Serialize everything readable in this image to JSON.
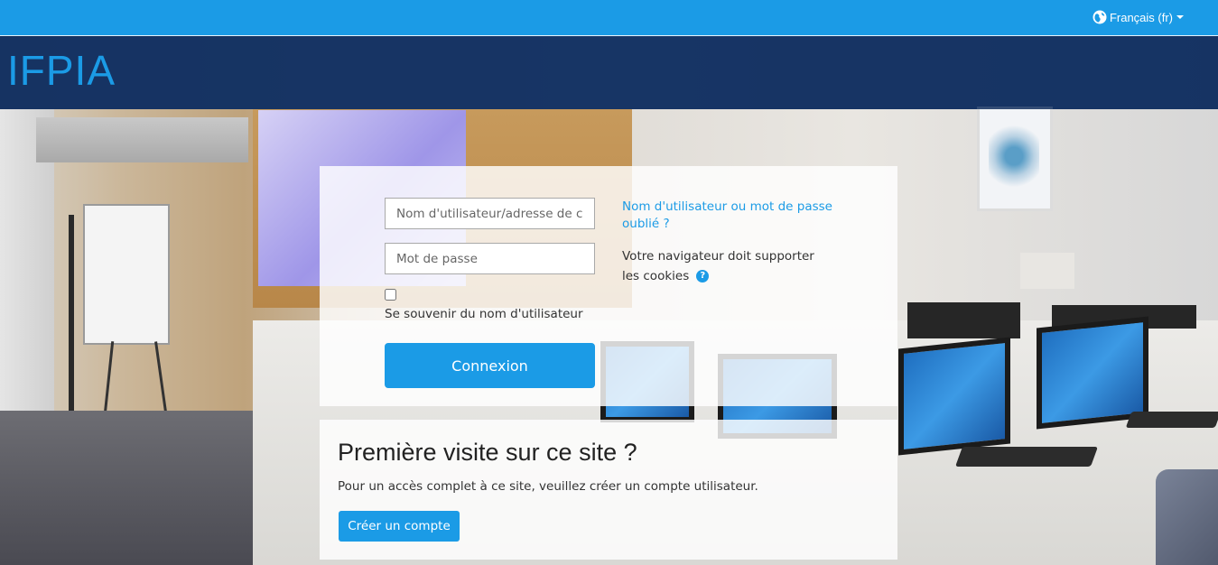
{
  "navbar": {
    "language_label": "Français (fr)",
    "globe_icon": "globe-icon",
    "caret_icon": "caret-down-icon",
    "color": "#1b9be6"
  },
  "header": {
    "site_name": "IFPIA"
  },
  "login": {
    "username_placeholder": "Nom d'utilisateur/adresse de courriel",
    "password_placeholder": "Mot de passe",
    "remember_label": "Se souvenir du nom d'utilisateur",
    "remember_checked": false,
    "submit_label": "Connexion",
    "forgot_link": "Nom d'utilisateur ou mot de passe oublié ?",
    "cookies_note": "Votre navigateur doit supporter les cookies",
    "help_icon": "question-circle-icon"
  },
  "signup": {
    "title": "Première visite sur ce site ?",
    "text": "Pour un accès complet à ce site, veuillez créer un compte utilisateur.",
    "button_label": "Créer un compte"
  },
  "colors": {
    "accent": "#1b9be6",
    "header_band": "#163464"
  }
}
